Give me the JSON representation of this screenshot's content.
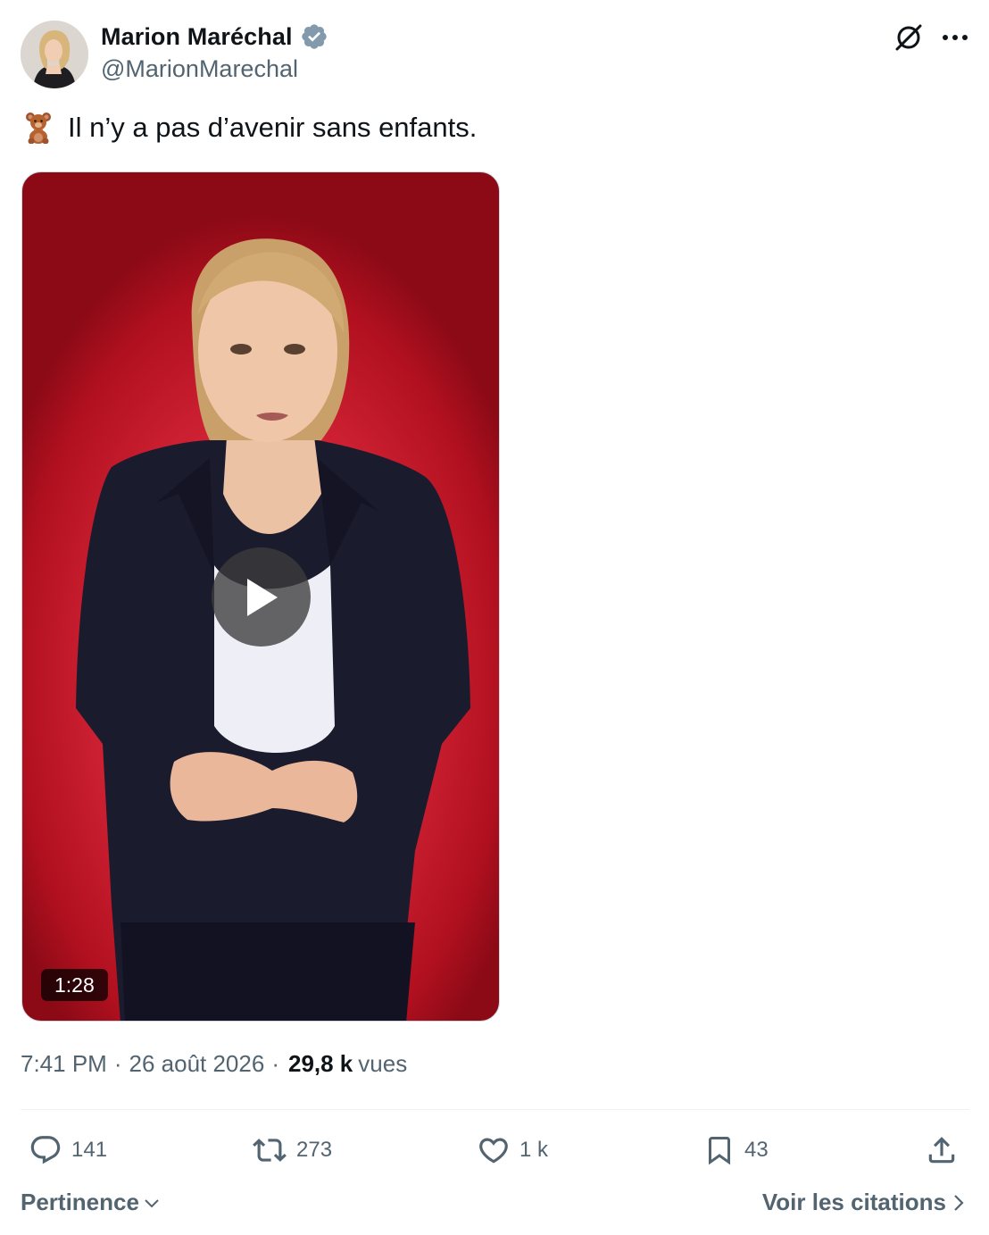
{
  "author": {
    "name": "Marion Maréchal",
    "handle": "@MarionMarechal",
    "avatar_icon": "profile-photo",
    "verified_icon": "verified-badge-icon"
  },
  "header_actions": {
    "grok_icon": "grok-icon",
    "more_icon": "more-dots-icon"
  },
  "tweet": {
    "emoji_icon": "teddy-bear-emoji",
    "text": "Il n’y a pas d’avenir sans enfants."
  },
  "video": {
    "duration": "1:28",
    "play_icon": "play-icon"
  },
  "meta": {
    "time": "7:41 PM",
    "separator": "·",
    "date": "26 août 2026",
    "views_count": "29,8 k",
    "views_label": "vues"
  },
  "actions": {
    "replies": "141",
    "reposts": "273",
    "likes": "1 k",
    "bookmarks": "43"
  },
  "footer": {
    "sort_label": "Pertinence",
    "quotes_label": "Voir les citations"
  },
  "colors": {
    "text_primary": "#0f1419",
    "text_secondary": "#536471",
    "verified_badge": "#829aab",
    "video_background": "#d9283b"
  }
}
